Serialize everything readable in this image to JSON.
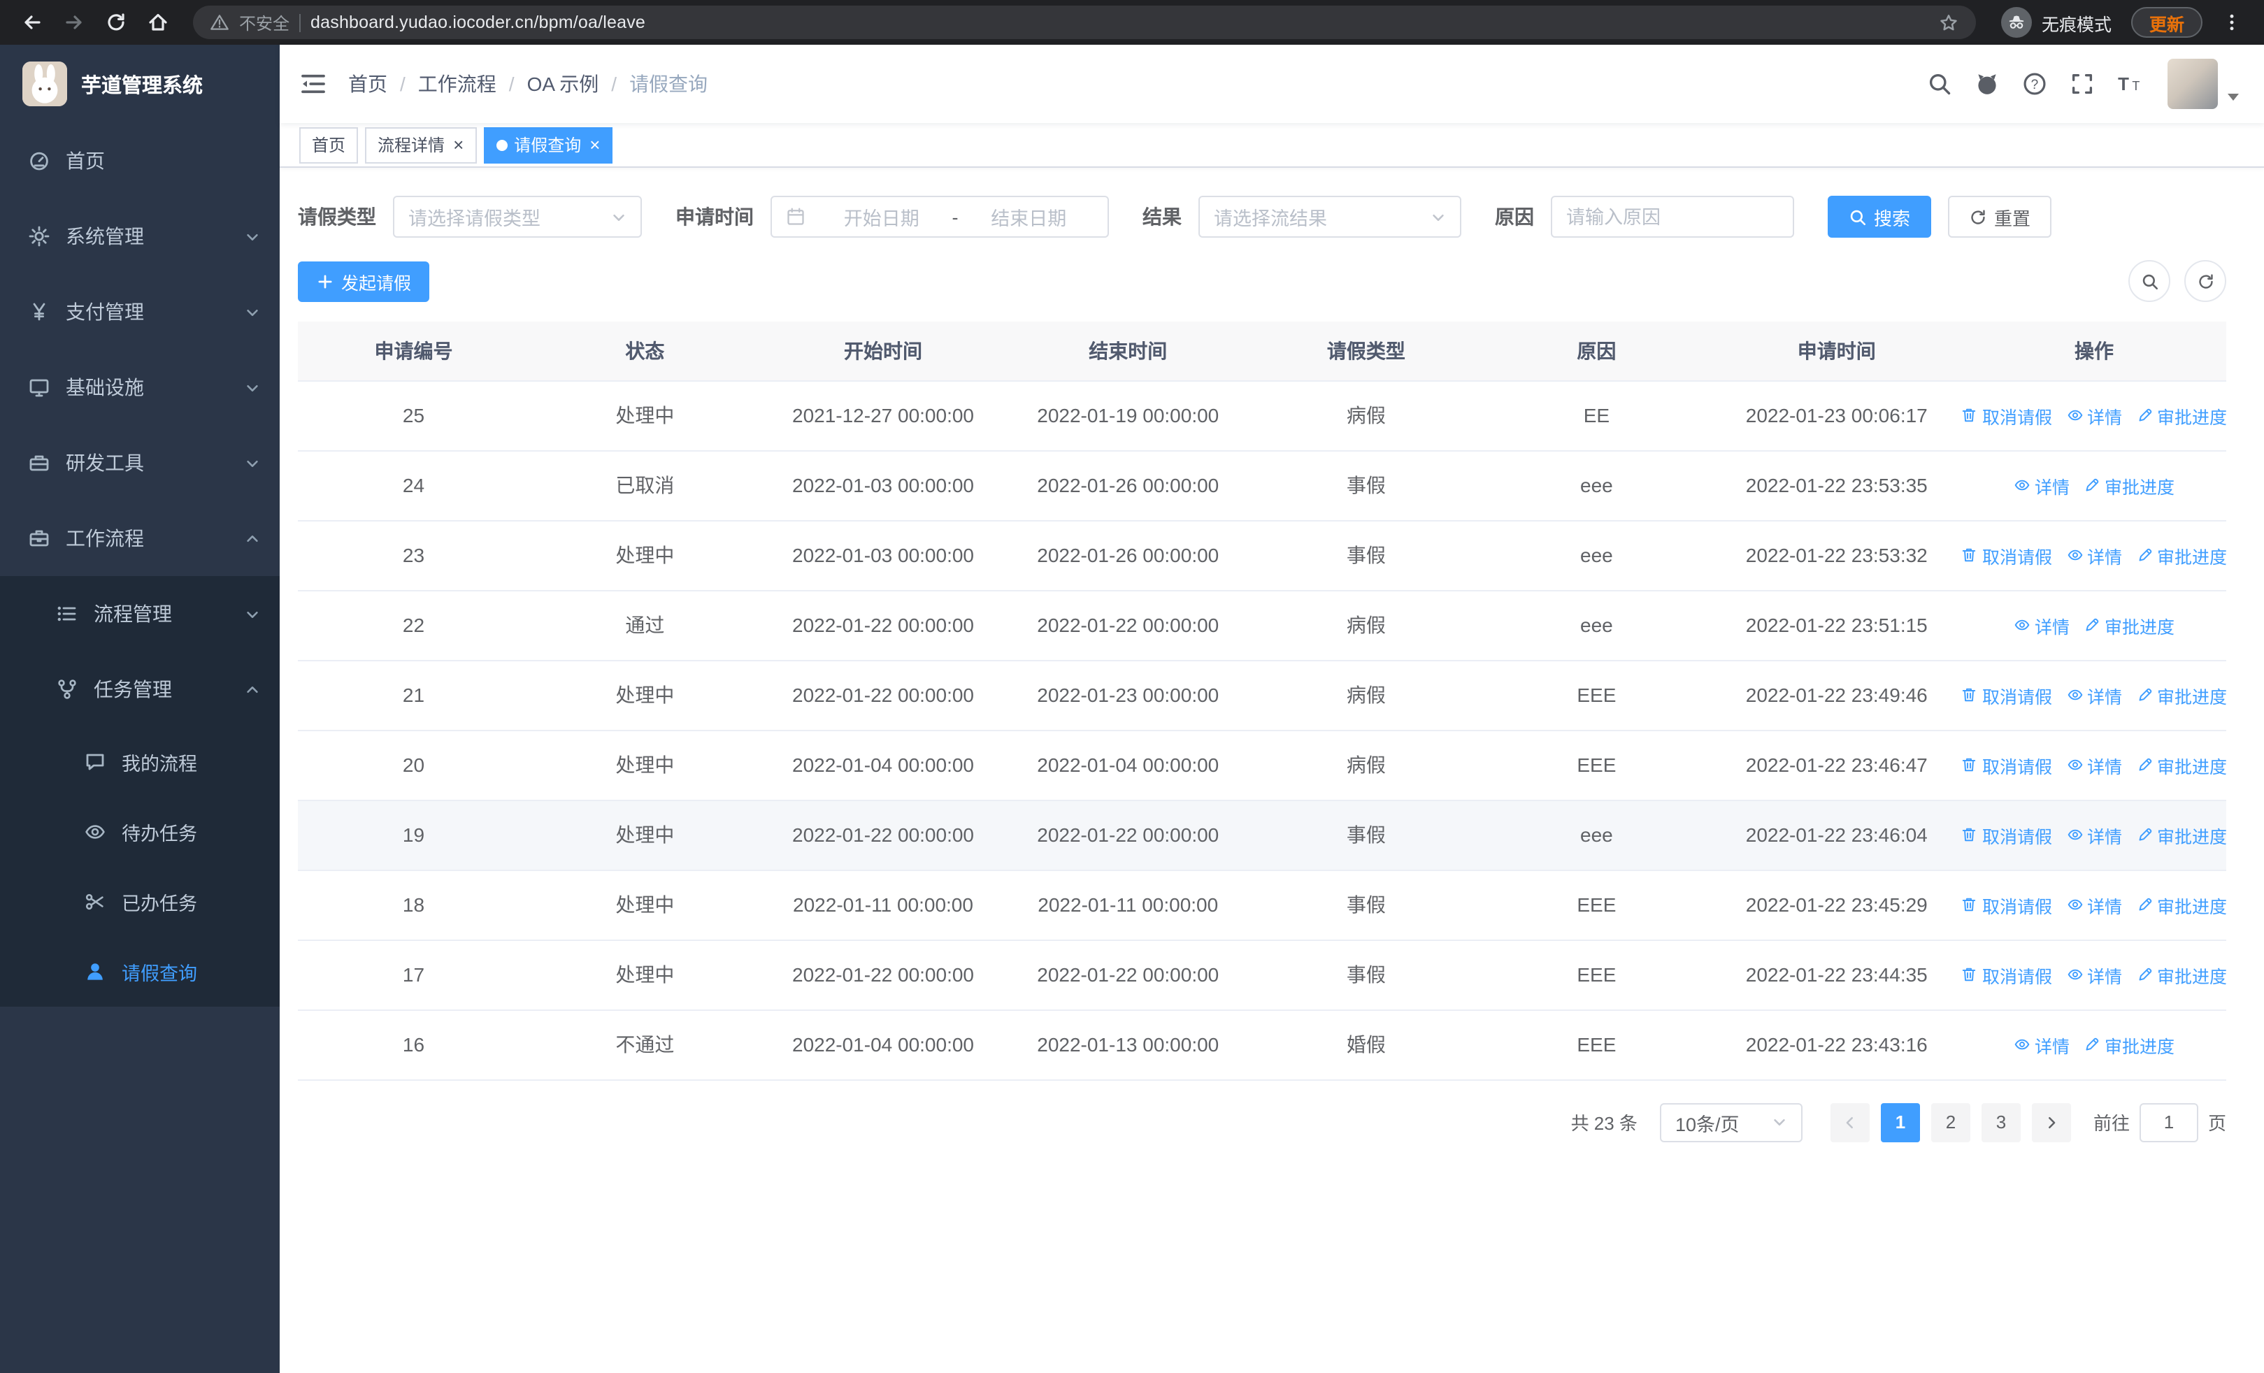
{
  "browser": {
    "security_label": "不安全",
    "url": "dashboard.yudao.iocoder.cn/bpm/oa/leave",
    "incognito_label": "无痕模式",
    "update_label": "更新"
  },
  "sidebar": {
    "logo_title": "芋道管理系统",
    "items": [
      {
        "label": "首页",
        "icon": "dashboard-icon"
      },
      {
        "label": "系统管理",
        "icon": "gear-icon"
      },
      {
        "label": "支付管理",
        "icon": "yen-icon"
      },
      {
        "label": "基础设施",
        "icon": "monitor-icon"
      },
      {
        "label": "研发工具",
        "icon": "toolbox-icon"
      },
      {
        "label": "工作流程",
        "icon": "briefcase-icon"
      }
    ],
    "workflow_children": [
      {
        "label": "流程管理",
        "icon": "list-icon"
      },
      {
        "label": "任务管理",
        "icon": "branch-icon"
      }
    ],
    "task_children": [
      {
        "label": "我的流程",
        "icon": "message-icon"
      },
      {
        "label": "待办任务",
        "icon": "eye-icon"
      },
      {
        "label": "已办任务",
        "icon": "scissors-icon"
      },
      {
        "label": "请假查询",
        "icon": "user-icon"
      }
    ]
  },
  "header": {
    "breadcrumb": [
      "首页",
      "工作流程",
      "OA 示例",
      "请假查询"
    ],
    "separator": "/"
  },
  "tabs": [
    {
      "label": "首页"
    },
    {
      "label": "流程详情",
      "closable": true
    },
    {
      "label": "请假查询",
      "closable": true,
      "active": true
    }
  ],
  "filters": {
    "leave_type_label": "请假类型",
    "leave_type_placeholder": "请选择请假类型",
    "apply_time_label": "申请时间",
    "start_date_placeholder": "开始日期",
    "range_separator": "-",
    "end_date_placeholder": "结束日期",
    "result_label": "结果",
    "result_placeholder": "请选择流结果",
    "reason_label": "原因",
    "reason_placeholder": "请输入原因",
    "search_label": "搜索",
    "reset_label": "重置"
  },
  "toolbar": {
    "create_label": "发起请假"
  },
  "table": {
    "columns": [
      "申请编号",
      "状态",
      "开始时间",
      "结束时间",
      "请假类型",
      "原因",
      "申请时间",
      "操作"
    ],
    "column_keys": [
      "id",
      "status",
      "start",
      "end",
      "type",
      "reason",
      "applied"
    ],
    "action_labels": {
      "cancel": "取消请假",
      "detail": "详情",
      "progress": "审批进度"
    },
    "action_icons": {
      "cancel": "trash-icon",
      "detail": "eye-icon",
      "progress": "edit-icon"
    },
    "rows": [
      {
        "id": "25",
        "status": "处理中",
        "start": "2021-12-27 00:00:00",
        "end": "2022-01-19 00:00:00",
        "type": "病假",
        "reason": "EE",
        "applied": "2022-01-23 00:06:17",
        "actions": [
          "cancel",
          "detail",
          "progress"
        ]
      },
      {
        "id": "24",
        "status": "已取消",
        "start": "2022-01-03 00:00:00",
        "end": "2022-01-26 00:00:00",
        "type": "事假",
        "reason": "eee",
        "applied": "2022-01-22 23:53:35",
        "actions": [
          "detail",
          "progress"
        ]
      },
      {
        "id": "23",
        "status": "处理中",
        "start": "2022-01-03 00:00:00",
        "end": "2022-01-26 00:00:00",
        "type": "事假",
        "reason": "eee",
        "applied": "2022-01-22 23:53:32",
        "actions": [
          "cancel",
          "detail",
          "progress"
        ]
      },
      {
        "id": "22",
        "status": "通过",
        "start": "2022-01-22 00:00:00",
        "end": "2022-01-22 00:00:00",
        "type": "病假",
        "reason": "eee",
        "applied": "2022-01-22 23:51:15",
        "actions": [
          "detail",
          "progress"
        ]
      },
      {
        "id": "21",
        "status": "处理中",
        "start": "2022-01-22 00:00:00",
        "end": "2022-01-23 00:00:00",
        "type": "病假",
        "reason": "EEE",
        "applied": "2022-01-22 23:49:46",
        "actions": [
          "cancel",
          "detail",
          "progress"
        ]
      },
      {
        "id": "20",
        "status": "处理中",
        "start": "2022-01-04 00:00:00",
        "end": "2022-01-04 00:00:00",
        "type": "病假",
        "reason": "EEE",
        "applied": "2022-01-22 23:46:47",
        "actions": [
          "cancel",
          "detail",
          "progress"
        ]
      },
      {
        "id": "19",
        "status": "处理中",
        "start": "2022-01-22 00:00:00",
        "end": "2022-01-22 00:00:00",
        "type": "事假",
        "reason": "eee",
        "applied": "2022-01-22 23:46:04",
        "actions": [
          "cancel",
          "detail",
          "progress"
        ],
        "highlighted": true
      },
      {
        "id": "18",
        "status": "处理中",
        "start": "2022-01-11 00:00:00",
        "end": "2022-01-11 00:00:00",
        "type": "事假",
        "reason": "EEE",
        "applied": "2022-01-22 23:45:29",
        "actions": [
          "cancel",
          "detail",
          "progress"
        ]
      },
      {
        "id": "17",
        "status": "处理中",
        "start": "2022-01-22 00:00:00",
        "end": "2022-01-22 00:00:00",
        "type": "事假",
        "reason": "EEE",
        "applied": "2022-01-22 23:44:35",
        "actions": [
          "cancel",
          "detail",
          "progress"
        ]
      },
      {
        "id": "16",
        "status": "不通过",
        "start": "2022-01-04 00:00:00",
        "end": "2022-01-13 00:00:00",
        "type": "婚假",
        "reason": "EEE",
        "applied": "2022-01-22 23:43:16",
        "actions": [
          "detail",
          "progress"
        ]
      }
    ]
  },
  "pagination": {
    "total_label": "共 23 条",
    "page_size_label": "10条/页",
    "pages": [
      "1",
      "2",
      "3"
    ],
    "active_page": "1",
    "goto_label": "前往",
    "goto_value": "1",
    "page_unit_label": "页"
  }
}
